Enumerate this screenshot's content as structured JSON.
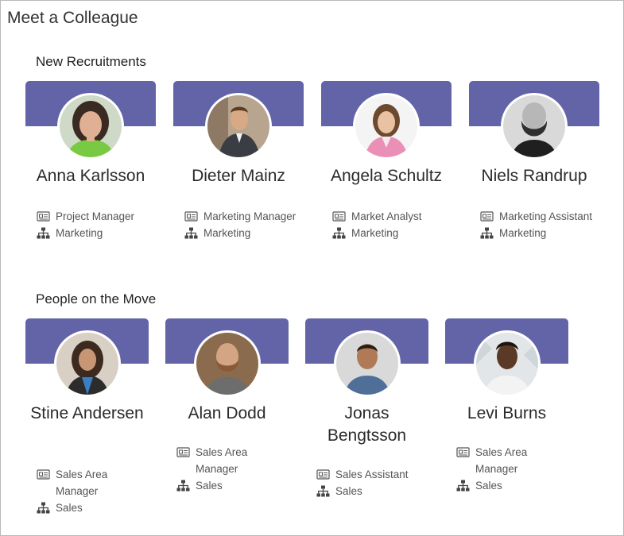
{
  "page": {
    "title": "Meet a Colleague"
  },
  "sections": [
    {
      "title": "New Recruitments",
      "people": [
        {
          "name": "Anna Karlsson",
          "role": "Project Manager",
          "department": "Marketing",
          "photo": "woman-smiling-photo"
        },
        {
          "name": "Dieter Mainz",
          "role": "Marketing Manager",
          "department": "Marketing",
          "photo": "man-in-suit-photo"
        },
        {
          "name": "Angela Schultz",
          "role": "Market Analyst",
          "department": "Marketing",
          "photo": "woman-pink-blazer-photo"
        },
        {
          "name": "Niels Randrup",
          "role": "Marketing Assistant",
          "department": "Marketing",
          "photo": "bearded-man-bw-photo"
        }
      ]
    },
    {
      "title": "People on the Move",
      "people": [
        {
          "name": "Stine Andersen",
          "role": "Sales Area Manager",
          "department": "Sales",
          "photo": "woman-curly-hair-photo"
        },
        {
          "name": "Alan Dodd",
          "role": "Sales Area Manager",
          "department": "Sales",
          "photo": "bearded-man-photo"
        },
        {
          "name": "Jonas Bengtsson",
          "role": "Sales Assistant",
          "department": "Sales",
          "photo": "man-smiling-photo"
        },
        {
          "name": "Levi Burns",
          "role": "Sales Area Manager",
          "department": "Sales",
          "photo": "man-white-shirt-photo"
        }
      ]
    }
  ],
  "icons": {
    "role": "id-card-icon",
    "department": "org-chart-icon"
  },
  "colors": {
    "banner": "#6264a7"
  }
}
